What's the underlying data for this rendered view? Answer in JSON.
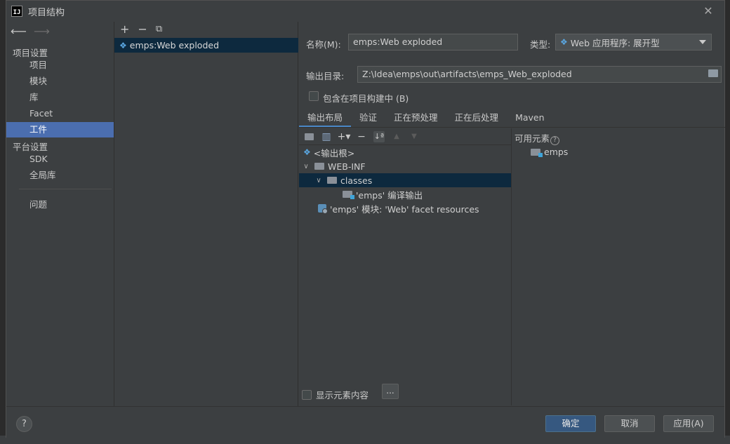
{
  "window": {
    "title": "项目结构",
    "app_icon_text": "IJ"
  },
  "nav": {
    "project_settings_label": "项目设置",
    "project_items": [
      "项目",
      "模块",
      "库",
      "Facet",
      "工件"
    ],
    "selected_index": 4,
    "platform_settings_label": "平台设置",
    "platform_items": [
      "SDK",
      "全局库"
    ],
    "problems_label": "问题"
  },
  "artifacts": {
    "toolbar": {
      "add": "+",
      "remove": "−",
      "copy": "⧉"
    },
    "items": [
      "emps:Web exploded"
    ]
  },
  "settings": {
    "name_label": "名称(M):",
    "name_value": "emps:Web exploded",
    "type_label": "类型:",
    "type_value": "Web 应用程序: 展开型",
    "output_label": "输出目录:",
    "output_value": "Z:\\Idea\\emps\\out\\artifacts\\emps_Web_exploded",
    "include_in_build_label": "包含在项目构建中 (B)",
    "include_in_build_checked": false,
    "tabs": [
      "输出布局",
      "验证",
      "正在预处理",
      "正在后处理",
      "Maven"
    ],
    "active_tab": 0,
    "layout_tree": [
      {
        "label": "<输出根>",
        "depth": 0,
        "kind": "root"
      },
      {
        "label": "WEB-INF",
        "depth": 0,
        "kind": "folder",
        "expanded": true
      },
      {
        "label": "classes",
        "depth": 1,
        "kind": "folder",
        "expanded": true,
        "selected": true
      },
      {
        "label": "'emps' 编译输出",
        "depth": 2,
        "kind": "module-output"
      },
      {
        "label": "'emps' 模块: 'Web' facet resources",
        "depth": 0,
        "kind": "facet"
      }
    ],
    "available_elements_label": "可用元素",
    "available_elements": [
      "emps"
    ],
    "show_content_label": "显示元素内容",
    "show_content_checked": false,
    "ellipsis_label": "..."
  },
  "footer": {
    "help": "?",
    "ok_label": "确定",
    "cancel_label": "取消",
    "apply_label": "应用(A)"
  },
  "colors": {
    "dialog_bg": "#3c3f41",
    "selection_nav": "#4b6eaf",
    "selection_tree": "#0d293e",
    "primary_button": "#365880",
    "tab_underline": "#4a88c7"
  }
}
